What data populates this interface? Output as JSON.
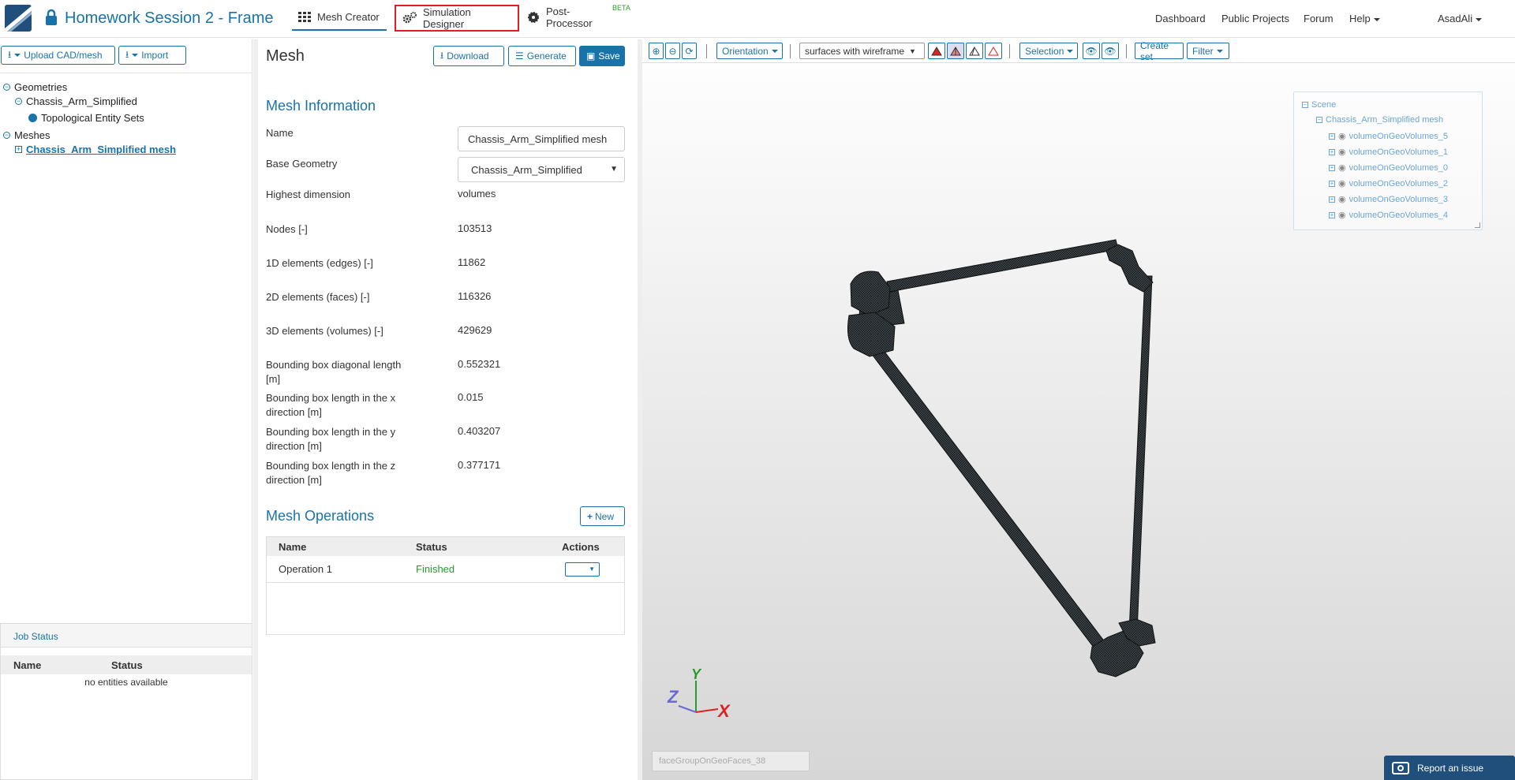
{
  "header": {
    "project_title": "Homework Session 2 - Frame",
    "tabs": [
      {
        "label": "Mesh Creator",
        "icon": "grid-icon"
      },
      {
        "label": "Simulation Designer",
        "icon": "gears-icon"
      },
      {
        "label": "Post-Processor",
        "icon": "gear-icon"
      }
    ],
    "beta_badge": "BETA",
    "right_nav": {
      "dashboard": "Dashboard",
      "public_projects": "Public Projects",
      "forum": "Forum",
      "help": "Help",
      "user": "AsadAli"
    }
  },
  "left": {
    "upload_label": "Upload CAD/mesh",
    "import_label": "Import",
    "tree": {
      "geometries": "Geometries",
      "geometry_item": "Chassis_Arm_Simplified",
      "entity_sets": "Topological Entity Sets",
      "meshes": "Meshes",
      "mesh_item": "Chassis_Arm_Simplified mesh"
    },
    "job_status": {
      "title": "Job Status",
      "col_name": "Name",
      "col_status": "Status",
      "empty": "no entities available"
    }
  },
  "mesh": {
    "title": "Mesh",
    "download_label": "Download",
    "generate_label": "Generate",
    "save_label": "Save",
    "info_title": "Mesh Information",
    "name_label": "Name",
    "name_value": "Chassis_Arm_Simplified mesh",
    "base_geometry_label": "Base Geometry",
    "base_geometry_value": "Chassis_Arm_Simplified",
    "highest_dim_label": "Highest dimension",
    "highest_dim_value": "volumes",
    "nodes_label": "Nodes [-]",
    "nodes_value": "103513",
    "edges_label": "1D elements (edges) [-]",
    "edges_value": "11862",
    "faces_label": "2D elements (faces) [-]",
    "faces_value": "116326",
    "volumes_label": "3D elements (volumes) [-]",
    "volumes_value": "429629",
    "bbox_diag_label": "Bounding box diagonal length [m]",
    "bbox_diag_value": "0.552321",
    "bbox_x_label": "Bounding box length in the x direction [m]",
    "bbox_x_value": "0.015",
    "bbox_y_label": "Bounding box length in the y direction [m]",
    "bbox_y_value": "0.403207",
    "bbox_z_label": "Bounding box length in the z direction [m]",
    "bbox_z_value": "0.377171",
    "ops_title": "Mesh Operations",
    "new_label": "New",
    "ops_cols": {
      "name": "Name",
      "status": "Status",
      "actions": "Actions"
    },
    "ops_row": {
      "name": "Operation 1",
      "status": "Finished"
    },
    "status_color": "#2a9a2a"
  },
  "viewer": {
    "orientation_label": "Orientation",
    "render_mode": "surfaces with wireframe",
    "selection_label": "Selection",
    "create_set_label": "Create set",
    "filter_label": "Filter",
    "scene": {
      "root": "Scene",
      "mesh": "Chassis_Arm_Simplified mesh",
      "volumes": [
        "volumeOnGeoVolumes_5",
        "volumeOnGeoVolumes_1",
        "volumeOnGeoVolumes_0",
        "volumeOnGeoVolumes_2",
        "volumeOnGeoVolumes_3",
        "volumeOnGeoVolumes_4"
      ]
    },
    "axes": {
      "x": "X",
      "y": "Y",
      "z": "Z"
    },
    "face_group": "faceGroupOnGeoFaces_38",
    "report_label": "Report an issue"
  },
  "colors": {
    "accent": "#1a73a8",
    "highlight_border": "#e02020",
    "brand_dark": "#1f4f7a"
  }
}
